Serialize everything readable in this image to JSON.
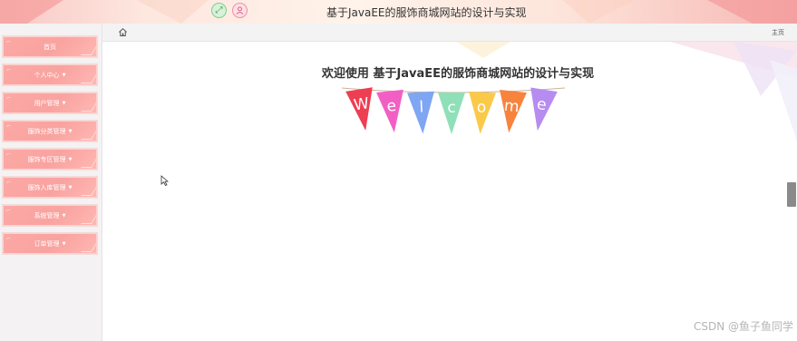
{
  "header": {
    "title": "基于JavaEE的服饰商城网站的设计与实现",
    "icons": [
      "fullscreen-icon",
      "user-icon"
    ]
  },
  "sidebar": {
    "items": [
      {
        "label": "首页",
        "has_caret": false
      },
      {
        "label": "个人中心",
        "has_caret": true
      },
      {
        "label": "用户管理",
        "has_caret": true
      },
      {
        "label": "服饰分类管理",
        "has_caret": true
      },
      {
        "label": "服饰专区管理",
        "has_caret": true
      },
      {
        "label": "服饰入库管理",
        "has_caret": true
      },
      {
        "label": "系统管理",
        "has_caret": true
      },
      {
        "label": "订单管理",
        "has_caret": true
      }
    ],
    "caret": "▼"
  },
  "breadcrumb": {
    "home_icon": "home-icon",
    "right_label": "主页"
  },
  "main": {
    "welcome_title": "欢迎使用 基于JavaEE的服饰商城网站的设计与实现",
    "bunting": {
      "letters": [
        "W",
        "e",
        "l",
        "c",
        "o",
        "m",
        "e"
      ],
      "colors": [
        "#ee3e52",
        "#f25fc4",
        "#7fa6f2",
        "#8fe0b8",
        "#fbc94a",
        "#f7833d",
        "#b78cf0"
      ]
    }
  },
  "watermark": "CSDN @鱼子鱼同学"
}
